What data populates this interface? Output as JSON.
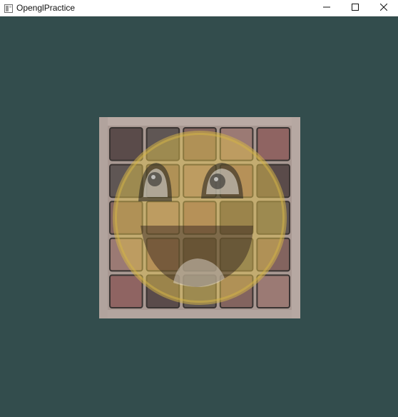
{
  "window": {
    "title": "OpenglPractice",
    "icon": "app-window-icon",
    "controls": {
      "minimize_icon": "minimize-icon",
      "maximize_icon": "maximize-icon",
      "close_icon": "close-icon"
    }
  },
  "viewport": {
    "clear_color": "#334d4d",
    "textures": {
      "base": "brick-pavement-texture",
      "overlay": "awesome-face-texture"
    },
    "grid": {
      "rows": 5,
      "cols": 5
    }
  }
}
